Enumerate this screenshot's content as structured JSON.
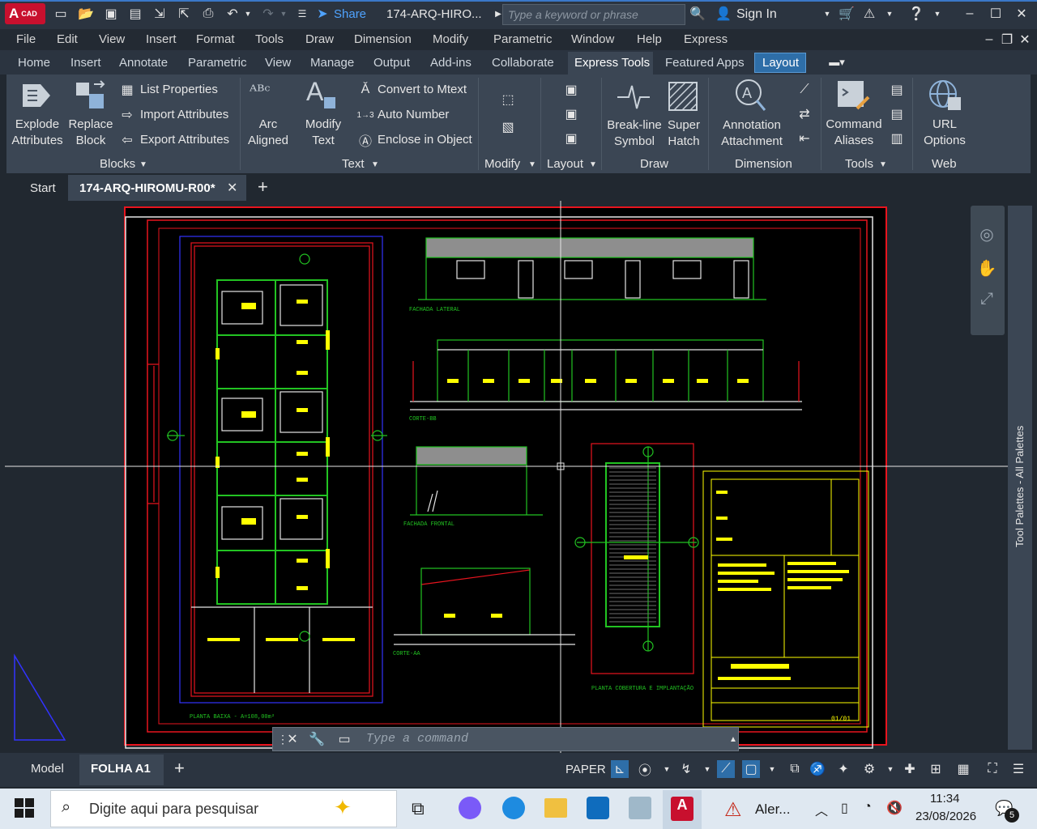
{
  "titlebar": {
    "logo_letter": "A",
    "logo_sub": "CAD",
    "share_label": "Share",
    "doc_title": "174-ARQ-HIRO...",
    "search_placeholder": "Type a keyword or phrase",
    "sign_in": "Sign In"
  },
  "menu": [
    "File",
    "Edit",
    "View",
    "Insert",
    "Format",
    "Tools",
    "Draw",
    "Dimension",
    "Modify",
    "Parametric",
    "Window",
    "Help",
    "Express"
  ],
  "ribbon_tabs": [
    "Home",
    "Insert",
    "Annotate",
    "Parametric",
    "View",
    "Manage",
    "Output",
    "Add-ins",
    "Collaborate",
    "Express Tools",
    "Featured Apps",
    "Layout"
  ],
  "ribbon": {
    "explode_attributes": [
      "Explode",
      "Attributes"
    ],
    "replace_block": [
      "Replace",
      "Block"
    ],
    "list_properties": "List Properties",
    "import_attributes": "Import Attributes",
    "export_attributes": "Export Attributes",
    "blocks_panel": "Blocks",
    "arc_aligned": [
      "Arc",
      "Aligned"
    ],
    "modify_text": [
      "Modify",
      "Text"
    ],
    "convert_mtext": "Convert to Mtext",
    "auto_number": "Auto Number",
    "enclose_object": "Enclose in Object",
    "text_panel": "Text",
    "modify_panel": "Modify",
    "layout_panel": "Layout",
    "breakline": [
      "Break-line",
      "Symbol"
    ],
    "superhatch": [
      "Super",
      "Hatch"
    ],
    "draw_panel": "Draw",
    "annotation_attachment": [
      "Annotation",
      "Attachment"
    ],
    "dimension_panel": "Dimension",
    "command_aliases": [
      "Command",
      "Aliases"
    ],
    "tools_panel": "Tools",
    "url_options": [
      "URL",
      "Options"
    ],
    "web_panel": "Web"
  },
  "doc_tabs": {
    "start": "Start",
    "active": "174-ARQ-HIROMU-R00*"
  },
  "drawing": {
    "labels": {
      "fachada_lateral": "FACHADA LATERAL",
      "corte_bb": "CORTE-BB",
      "fachada_frontal": "FACHADA FRONTAL",
      "corte_aa": "CORTE-AA",
      "planta_baixa": "PLANTA BAIXA - A=108,00m²",
      "planta_cobertura": "PLANTA COBERTURA E IMPLANTAÇÃO",
      "sheet_number": "01/01"
    }
  },
  "command": {
    "placeholder": "Type a command"
  },
  "tool_palettes_title": "Tool Palettes - All Palettes",
  "layout_tabs": {
    "model": "Model",
    "active": "FOLHA A1"
  },
  "status": {
    "space": "PAPER"
  },
  "taskbar": {
    "search_placeholder": "Digite aqui para pesquisar",
    "alert_label": "Aler...",
    "time": "11:34",
    "date": "23/08/2026",
    "notifications": "5"
  },
  "colors": {
    "accent": "#2e6ea8",
    "title_red": "#c8102e",
    "cad_red": "#e8141e",
    "cad_yellow": "#ffff00",
    "cad_green": "#22c322",
    "cad_blue": "#3232ff"
  }
}
